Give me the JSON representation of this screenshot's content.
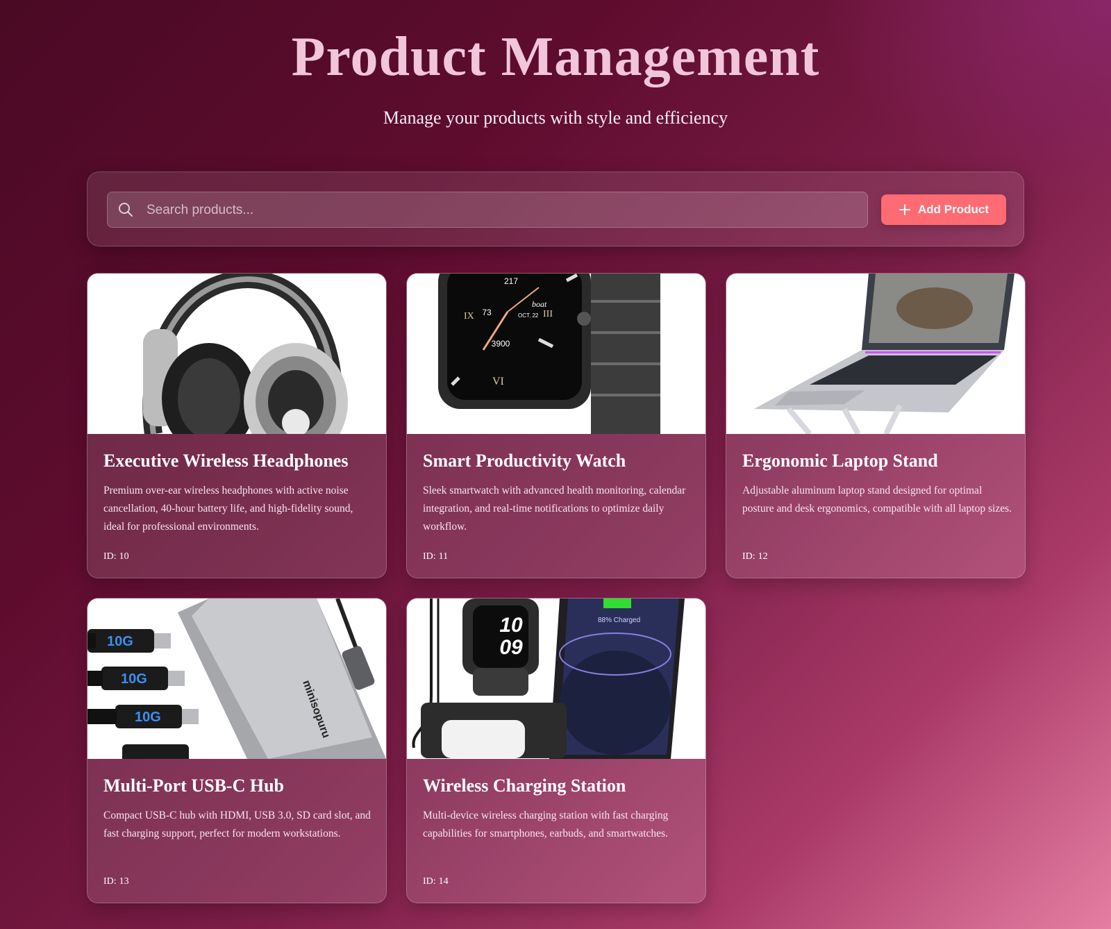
{
  "header": {
    "title": "Product Management",
    "subtitle": "Manage your products with style and efficiency"
  },
  "toolbar": {
    "search_placeholder": "Search products...",
    "search_icon": "search-icon",
    "add_button_label": "Add Product",
    "add_button_icon": "plus-icon",
    "accent_color": "#ff6b73"
  },
  "products": [
    {
      "title": "Executive Wireless Headphones",
      "description": "Premium over-ear wireless headphones with active noise cancellation, 40-hour battery life, and high-fidelity sound, ideal for professional environments.",
      "id_label": "ID:",
      "id": "10",
      "image": "headphones-image"
    },
    {
      "title": "Smart Productivity Watch",
      "description": "Sleek smartwatch with advanced health monitoring, calendar integration, and real-time notifications to optimize daily workflow.",
      "id_label": "ID:",
      "id": "11",
      "image": "smartwatch-image",
      "image_text": {
        "top": "217",
        "left": "73",
        "brand": "boat",
        "date": "OCT. 22",
        "bottom": "3900",
        "numeral_left": "IX",
        "numeral_right": "III",
        "numeral_bottom": "VI"
      }
    },
    {
      "title": "Ergonomic Laptop Stand",
      "description": "Adjustable aluminum laptop stand designed for optimal posture and desk ergonomics, compatible with all laptop sizes.",
      "id_label": "ID:",
      "id": "12",
      "image": "laptop-stand-image"
    },
    {
      "title": "Multi-Port USB-C Hub",
      "description": "Compact USB-C hub with HDMI, USB 3.0, SD card slot, and fast charging support, perfect for modern workstations.",
      "id_label": "ID:",
      "id": "13",
      "image": "usb-hub-image",
      "image_text": {
        "cable_label": "10G",
        "brand": "minisopuru"
      }
    },
    {
      "title": "Wireless Charging Station",
      "description": "Multi-device wireless charging station with fast charging capabilities for smartphones, earbuds, and smartwatches.",
      "id_label": "ID:",
      "id": "14",
      "image": "charging-station-image",
      "image_text": {
        "watch_hours": "10",
        "watch_minutes": "09",
        "phone_status": "88% Charged"
      }
    }
  ]
}
